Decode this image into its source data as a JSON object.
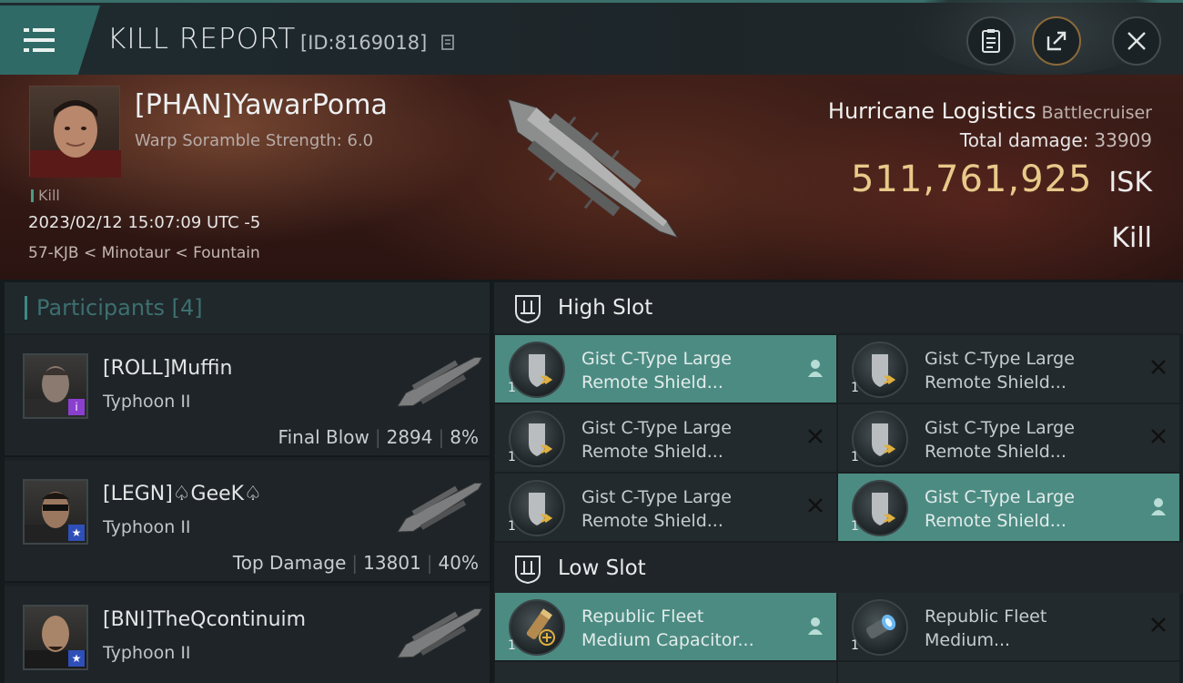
{
  "header": {
    "title": "KILL REPORT",
    "report_id": "[ID:8169018]",
    "icons": [
      "menu-icon",
      "copy-icon",
      "clipboard-icon",
      "share-icon",
      "close-icon"
    ]
  },
  "victim": {
    "name": "[PHAN]YawarPoma",
    "warp_scramble": "Warp Soramble Strength: 6.0",
    "tag": "Kill",
    "datetime": "2023/02/12 15:07:09 UTC -5",
    "location": "57-KJB < Minotaur < Fountain",
    "ship": "Hurricane Logistics",
    "ship_class": "Battlecruiser",
    "total_damage_label": "Total damage:",
    "total_damage": "33909",
    "isk_value": "511,761,925",
    "isk_unit": "ISK",
    "status": "Kill"
  },
  "participants": {
    "label": "Participants",
    "count": "[4]",
    "list": [
      {
        "name": "[ROLL]Muffin",
        "ship": "Typhoon II",
        "role": "Final Blow",
        "damage": "2894",
        "percent": "8%",
        "badge": "i",
        "badge_color": "#8a3fcf"
      },
      {
        "name": "[LEGN]♤GeeK♤",
        "ship": "Typhoon II",
        "role": "Top Damage",
        "damage": "13801",
        "percent": "40%",
        "badge": "★",
        "badge_color": "#2e4fb8"
      },
      {
        "name": "[BNI]TheQcontinuim",
        "ship": "Typhoon II",
        "role": "",
        "damage": "",
        "percent": "",
        "badge": "★",
        "badge_color": "#2e4fb8"
      }
    ]
  },
  "slots": {
    "high": {
      "label": "High Slot",
      "modules": [
        {
          "line1": "Gist C-Type Large",
          "line2": "Remote Shield...",
          "qty": "1",
          "state": "dropped"
        },
        {
          "line1": "Gist C-Type Large",
          "line2": "Remote Shield...",
          "qty": "1",
          "state": "destroyed"
        },
        {
          "line1": "Gist C-Type Large",
          "line2": "Remote Shield...",
          "qty": "1",
          "state": "destroyed"
        },
        {
          "line1": "Gist C-Type Large",
          "line2": "Remote Shield...",
          "qty": "1",
          "state": "destroyed"
        },
        {
          "line1": "Gist C-Type Large",
          "line2": "Remote Shield...",
          "qty": "1",
          "state": "destroyed"
        },
        {
          "line1": "Gist C-Type Large",
          "line2": "Remote Shield...",
          "qty": "1",
          "state": "dropped"
        }
      ]
    },
    "low": {
      "label": "Low Slot",
      "modules": [
        {
          "line1": "Republic Fleet",
          "line2": "Medium Capacitor...",
          "qty": "1",
          "state": "dropped"
        },
        {
          "line1": "Republic Fleet",
          "line2": "Medium...",
          "qty": "1",
          "state": "destroyed"
        }
      ]
    }
  }
}
